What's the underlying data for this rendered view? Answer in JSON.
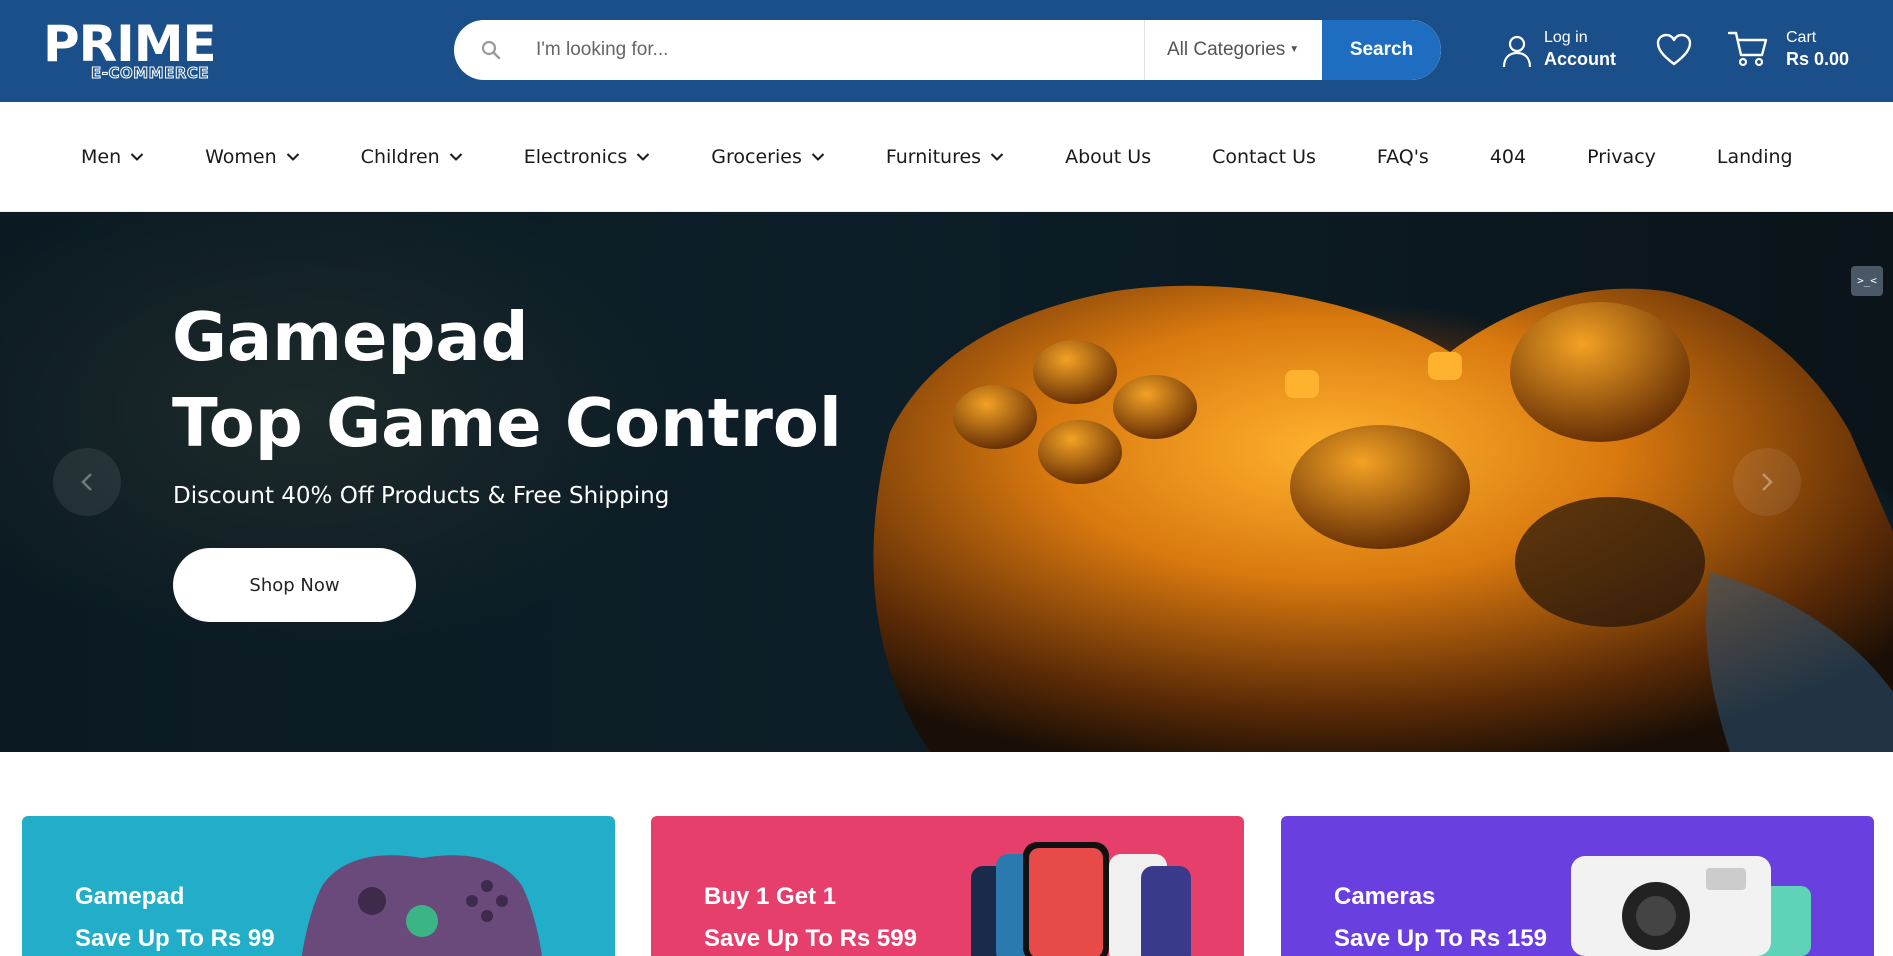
{
  "header": {
    "logo_main": "PRIME",
    "logo_sub": "E-COMMERCE",
    "search": {
      "placeholder": "I'm looking for...",
      "category_label": "All Categories",
      "button_label": "Search"
    },
    "account": {
      "small": "Log in",
      "big": "Account"
    },
    "cart": {
      "small": "Cart",
      "big": "Rs 0.00"
    }
  },
  "nav": {
    "items": [
      {
        "label": "Men",
        "dropdown": true
      },
      {
        "label": "Women",
        "dropdown": true
      },
      {
        "label": "Children",
        "dropdown": true
      },
      {
        "label": "Electronics",
        "dropdown": true
      },
      {
        "label": "Groceries",
        "dropdown": true
      },
      {
        "label": "Furnitures",
        "dropdown": true
      },
      {
        "label": "About Us",
        "dropdown": false
      },
      {
        "label": "Contact Us",
        "dropdown": false
      },
      {
        "label": "FAQ's",
        "dropdown": false
      },
      {
        "label": "404",
        "dropdown": false
      },
      {
        "label": "Privacy",
        "dropdown": false
      },
      {
        "label": "Landing",
        "dropdown": false
      }
    ]
  },
  "hero": {
    "title_line1": "Gamepad",
    "title_line2": "Top Game Control",
    "subtitle": "Discount 40% Off Products & Free Shipping",
    "button_label": "Shop Now",
    "badge": ">_<"
  },
  "promos": [
    {
      "title": "Gamepad",
      "subtitle": "Save Up To Rs 99",
      "color": "#22aec8"
    },
    {
      "title": "Buy 1 Get 1",
      "subtitle": "Save Up To Rs 599",
      "color": "#e63f6b"
    },
    {
      "title": "Cameras",
      "subtitle": "Save Up To Rs 159",
      "color": "#6a3fe0"
    }
  ],
  "colors": {
    "header_bg": "#1b4f8a",
    "search_button": "#1e6dc0"
  }
}
